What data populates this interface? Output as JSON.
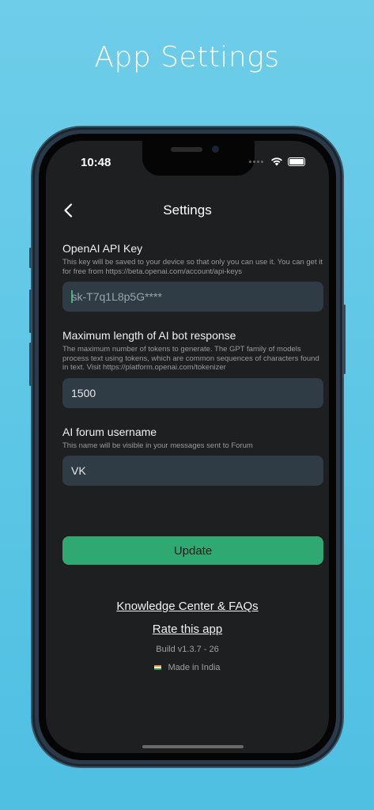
{
  "promo": {
    "title": "App Settings"
  },
  "status_bar": {
    "time": "10:48"
  },
  "nav": {
    "title": "Settings"
  },
  "fields": [
    {
      "label": "OpenAI API Key",
      "description": "This key will be saved to your device so that only you can use it. You can get it for free from https://beta.openai.com/account/api-keys",
      "value": "sk-T7q1L8p5G****"
    },
    {
      "label": "Maximum length of AI bot response",
      "description": "The maximum number of tokens to generate. The GPT family of models process text using tokens, which are common sequences of characters found in text. Visit https://platform.openai.com/tokenizer",
      "value": "1500"
    },
    {
      "label": "AI forum username",
      "description": "This name will be visible in your messages sent to Forum",
      "value": "VK"
    }
  ],
  "actions": {
    "update_label": "Update"
  },
  "footer": {
    "knowledge_link": "Knowledge Center & FAQs",
    "rate_link": "Rate this app",
    "build": "Build v1.3.7 - 26",
    "made_in": "Made in India"
  },
  "colors": {
    "background": "#5ec7e6",
    "screen": "#1e1f21",
    "input": "#2f3c45",
    "accent": "#2fa871"
  },
  "icons": [
    "back-chevron-icon",
    "wifi-icon",
    "battery-icon",
    "india-flag-icon"
  ]
}
